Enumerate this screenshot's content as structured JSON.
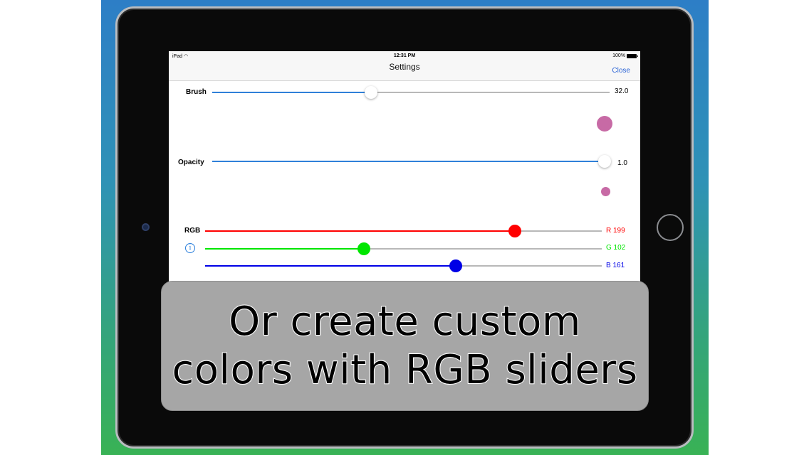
{
  "status_bar": {
    "device": "iPad",
    "time": "12:31 PM",
    "battery": "100%"
  },
  "navbar": {
    "title": "Settings",
    "close_label": "Close"
  },
  "brush": {
    "label": "Brush",
    "value_text": "32.0",
    "fraction": 0.4
  },
  "opacity": {
    "label": "Opacity",
    "value_text": "1.0",
    "fraction": 1.0
  },
  "rgb": {
    "label": "RGB",
    "r": {
      "value_text": "R 199",
      "value": 199,
      "max": 255
    },
    "g": {
      "value_text": "G 102",
      "value": 102,
      "max": 255
    },
    "b": {
      "value_text": "B 161",
      "value": 161,
      "max": 255
    }
  },
  "icons": {
    "info": "info-icon",
    "wifi": "wifi-icon",
    "battery": "battery-icon"
  },
  "colors": {
    "accent": "#2a63d6",
    "slider_track": "#2f80d9",
    "red": "#ff0000",
    "green": "#00e600",
    "blue": "#0000e6",
    "preview": "#c76aa5",
    "backdrop_top": "#2d7ec6",
    "backdrop_bottom": "#39b255"
  },
  "caption": {
    "line1": "Or create custom",
    "line2": "colors with RGB sliders"
  }
}
